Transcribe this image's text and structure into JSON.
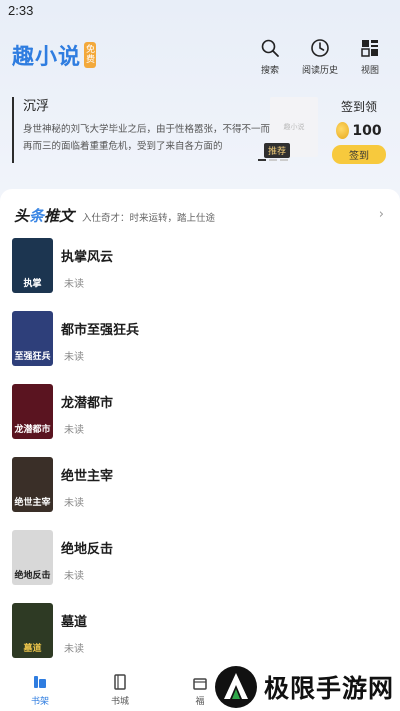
{
  "status_bar": {
    "time": "2:33"
  },
  "app": {
    "logo_text": "趣小说",
    "logo_tag": "免费"
  },
  "top_actions": [
    {
      "icon": "search-icon",
      "label": "搜索"
    },
    {
      "icon": "clock-icon",
      "label": "阅读历史"
    },
    {
      "icon": "grid-view-icon",
      "label": "视图"
    }
  ],
  "banner": {
    "title": "沉浮",
    "description": "身世神秘的刘飞大学毕业之后，由于性格嚣张，不得不一而再再而三的面临着重重危机，受到了来自各方面的",
    "cover_text": "趣小说",
    "tag": "推荐"
  },
  "signin": {
    "title": "签到领",
    "points": "100",
    "button": "签到"
  },
  "section": {
    "title_part1": "头",
    "title_accent": "条",
    "title_part2": "推文",
    "subtitle": "入仕奇才：时来运转，踏上仕途",
    "arrow": "›"
  },
  "books": [
    {
      "title": "执掌风云",
      "status": "未读",
      "cover_text": "执掌",
      "cover_color": "#1c3550"
    },
    {
      "title": "都市至强狂兵",
      "status": "未读",
      "cover_text": "至强狂兵",
      "cover_color": "#2e3f7a"
    },
    {
      "title": "龙潜都市",
      "status": "未读",
      "cover_text": "龙潜都市",
      "cover_color": "#5a1420"
    },
    {
      "title": "绝世主宰",
      "status": "未读",
      "cover_text": "绝世主宰",
      "cover_color": "#3a2f28"
    },
    {
      "title": "绝地反击",
      "status": "未读",
      "cover_text": "绝地反击",
      "cover_color": "#d8d8d8"
    },
    {
      "title": "墓道",
      "status": "未读",
      "cover_text": "墓道",
      "cover_color": "#2e3a24"
    }
  ],
  "tabbar": [
    {
      "icon": "bookshelf-icon",
      "label": "书架",
      "active": true
    },
    {
      "icon": "bookstore-icon",
      "label": "书城",
      "active": false
    },
    {
      "icon": "welfare-icon",
      "label": "福",
      "active": false
    }
  ],
  "watermark": {
    "text": "极限手游网"
  },
  "colors": {
    "accent": "#2f7de0",
    "signin_button": "#f7c93d"
  }
}
